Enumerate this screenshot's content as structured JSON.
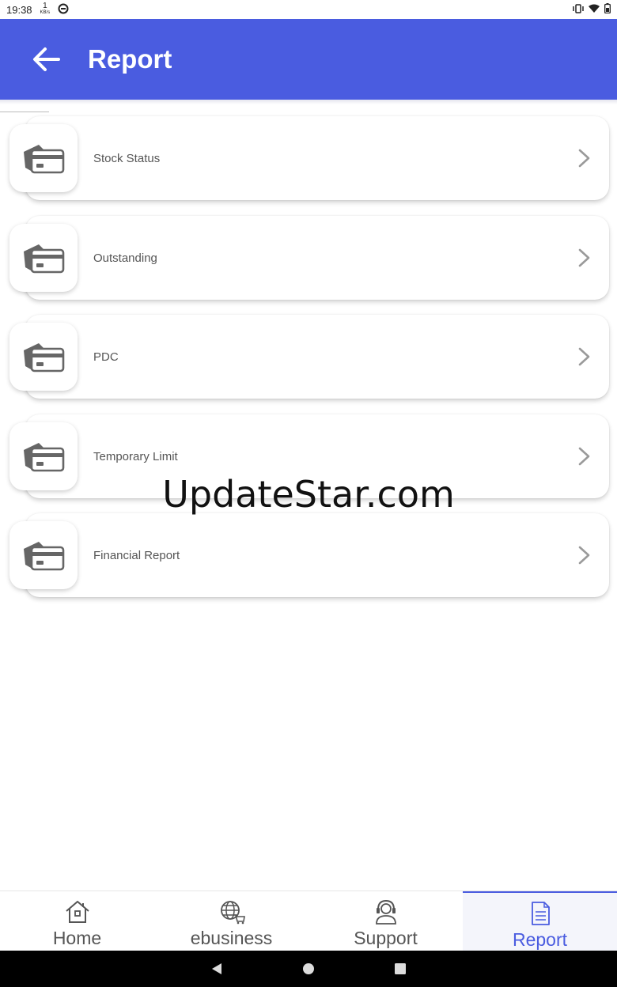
{
  "status_bar": {
    "time": "19:38",
    "net_speed_value": "1",
    "net_speed_unit": "KB/s"
  },
  "app_bar": {
    "title": "Report",
    "color": "#4a5ce0"
  },
  "report_items": [
    {
      "label": "Stock Status",
      "icon": "credit-card-icon"
    },
    {
      "label": "Outstanding",
      "icon": "credit-card-icon"
    },
    {
      "label": "PDC",
      "icon": "credit-card-icon"
    },
    {
      "label": "Temporary Limit",
      "icon": "credit-card-icon"
    },
    {
      "label": "Financial Report",
      "icon": "credit-card-icon"
    }
  ],
  "watermark": "UpdateStar.com",
  "bottom_nav": {
    "items": [
      {
        "label": "Home",
        "icon": "home-icon"
      },
      {
        "label": "ebusiness",
        "icon": "globe-cart-icon"
      },
      {
        "label": "Support",
        "icon": "support-agent-icon"
      },
      {
        "label": "Report",
        "icon": "document-icon",
        "active": true
      }
    ]
  }
}
